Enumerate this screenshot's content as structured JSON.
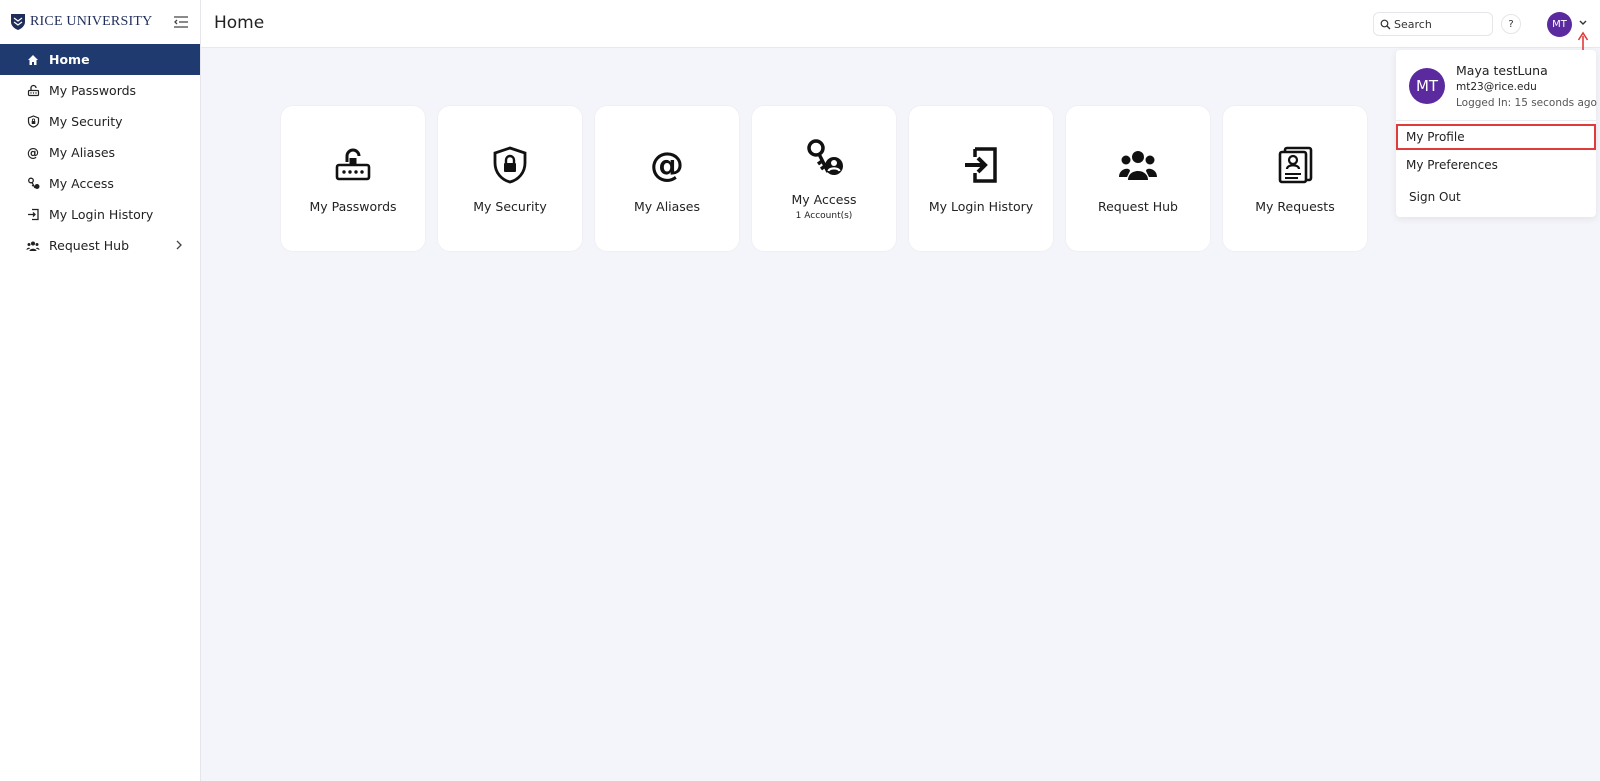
{
  "brand": {
    "name": "RICE UNIVERSITY"
  },
  "header": {
    "title": "Home"
  },
  "search": {
    "placeholder": "Search"
  },
  "help": {
    "label": "?"
  },
  "user": {
    "initials": "MT",
    "name": "Maya testLuna",
    "email": "mt23@rice.edu",
    "logged_in": "Logged In: 15 seconds ago",
    "avatar_color": "#5b2a9e"
  },
  "sidebar": {
    "items": [
      {
        "label": "Home",
        "icon": "home-icon",
        "active": true
      },
      {
        "label": "My Passwords",
        "icon": "password-lock-icon"
      },
      {
        "label": "My Security",
        "icon": "shield-icon"
      },
      {
        "label": "My Aliases",
        "icon": "at-icon"
      },
      {
        "label": "My Access",
        "icon": "key-user-icon"
      },
      {
        "label": "My Login History",
        "icon": "login-icon"
      },
      {
        "label": "Request Hub",
        "icon": "users-icon"
      }
    ]
  },
  "cards": [
    {
      "label": "My Passwords",
      "icon": "password-lock-icon"
    },
    {
      "label": "My Security",
      "icon": "shield-lock-icon"
    },
    {
      "label": "My Aliases",
      "icon": "at-icon"
    },
    {
      "label": "My Access",
      "sub": "1 Account(s)",
      "icon": "key-user-icon"
    },
    {
      "label": "My Login History",
      "icon": "login-icon"
    },
    {
      "label": "Request Hub",
      "icon": "users-icon"
    },
    {
      "label": "My Requests",
      "icon": "requests-icon"
    }
  ],
  "menu": {
    "profile": "My Profile",
    "preferences": "My Preferences",
    "sign_out": "Sign Out"
  },
  "colors": {
    "nav_active": "#1e3a6e",
    "highlight": "#e03b3b",
    "background": "#f4f5fa"
  }
}
